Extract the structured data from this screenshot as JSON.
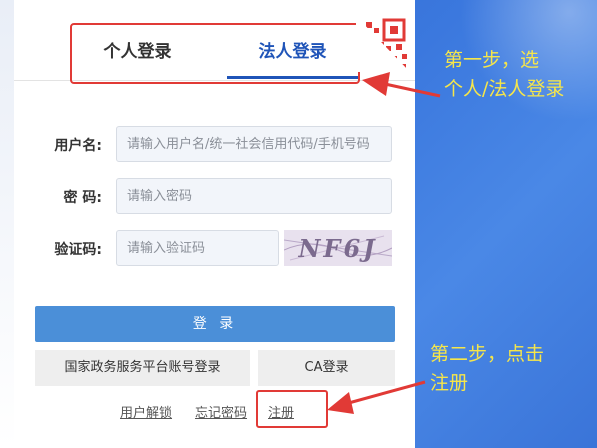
{
  "tabs": {
    "personal": "个人登录",
    "legal": "法人登录"
  },
  "form": {
    "username": {
      "label": "用户名:",
      "placeholder": "请输入用户名/统一社会信用代码/手机号码"
    },
    "password": {
      "label": "密 码:",
      "placeholder": "请输入密码"
    },
    "captcha": {
      "label": "验证码:",
      "placeholder": "请输入验证码",
      "image_text": "NF6J"
    }
  },
  "buttons": {
    "login": "登 录",
    "national_platform": "国家政务服务平台账号登录",
    "ca": "CA登录"
  },
  "links": {
    "unlock": "用户解锁",
    "forgot": "忘记密码",
    "register": "注册"
  },
  "annotations": {
    "step1_line1": "第一步，选",
    "step1_line2": "个人/法人登录",
    "step2_line1": "第二步，点击",
    "step2_line2": "注册"
  },
  "colors": {
    "accent": "#1f54b8",
    "login_button": "#4b8fd8",
    "annotation": "#f6e64a",
    "highlight": "#e13a36"
  },
  "icons": {
    "qr": "qr-code-icon",
    "arrow": "arrow-left-icon"
  }
}
